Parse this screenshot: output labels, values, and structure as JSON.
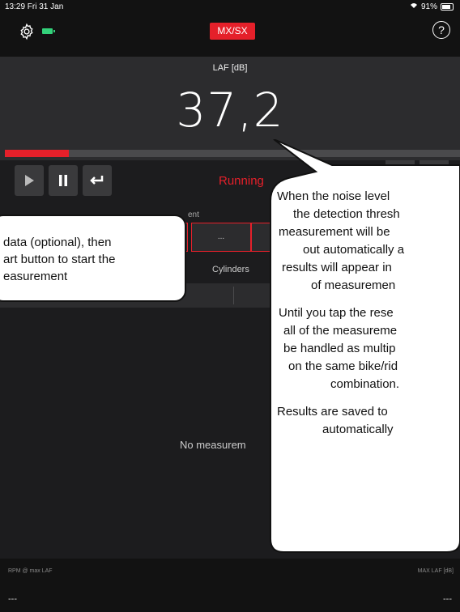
{
  "status": {
    "time": "13:29  Fri 31 Jan",
    "battery_pct": "91%"
  },
  "nav": {
    "mode_label": "MX/SX",
    "help_label": "?"
  },
  "meter": {
    "label": "LAF [dB]",
    "value": "37,2",
    "level_fraction": 0.14
  },
  "controls": {
    "status_text": "Running"
  },
  "setup": {
    "label_fragment": "ent",
    "boxes": [
      "",
      "...",
      ""
    ]
  },
  "tabs": {
    "cylinders_label": "Cylinders"
  },
  "empty_state": "No measurem",
  "footer": {
    "left_label": "RPM @ max LAF",
    "right_label": "MAX LAF [dB]",
    "left_value": "---",
    "right_value": "---"
  },
  "callout_left": {
    "lines": [
      "data (optional), then",
      "art button to start the",
      "easurement"
    ]
  },
  "callout_right": {
    "para1": [
      "When the noise level",
      "the detection thresh",
      "measurement will be",
      "out automatically a",
      "results will appear in",
      "of measuremen"
    ],
    "para2": [
      "Until you tap the rese",
      "all of the measureme",
      "be handled as multip",
      "on the same bike/rid",
      "combination."
    ],
    "para3": [
      "Results are saved to",
      "automatically"
    ]
  },
  "colors": {
    "accent_red": "#e5202a",
    "battery_green": "#33d17a",
    "background": "#1c1c1e"
  }
}
